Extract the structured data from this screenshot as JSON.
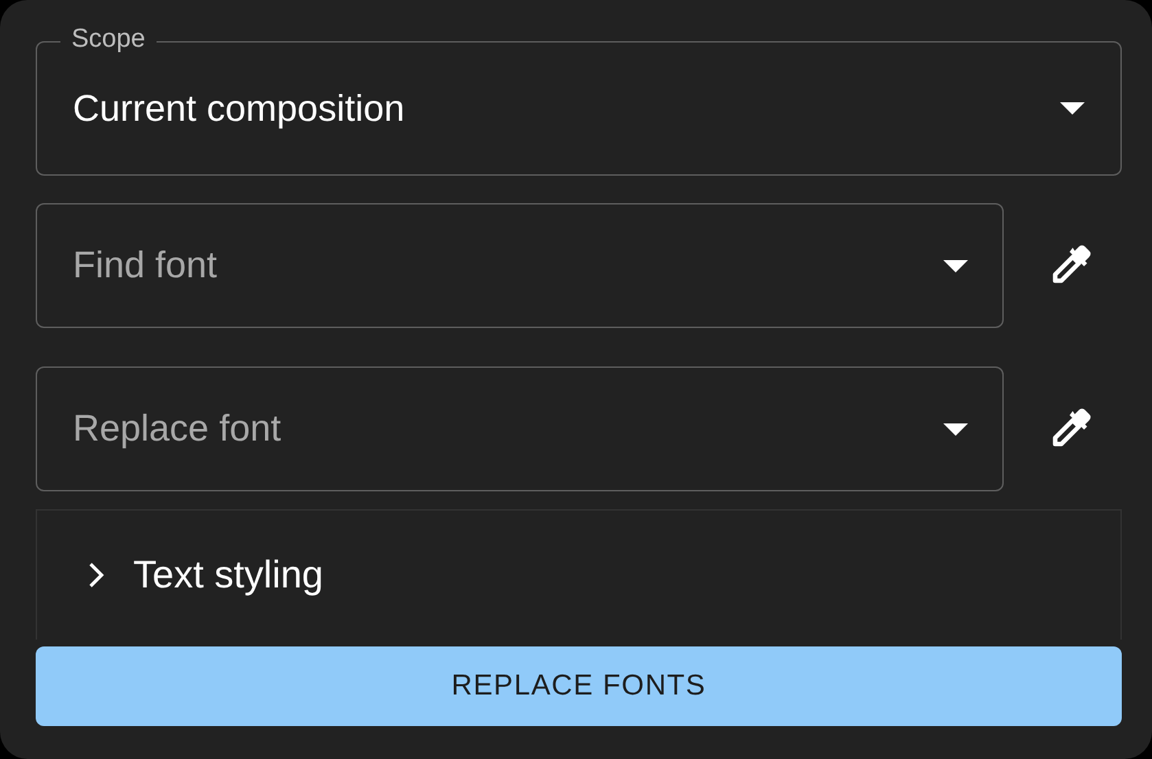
{
  "scope": {
    "label": "Scope",
    "value": "Current composition"
  },
  "find_font": {
    "placeholder": "Find font"
  },
  "replace_font": {
    "placeholder": "Replace font"
  },
  "text_styling": {
    "label": "Text styling",
    "expanded": false
  },
  "button": {
    "label": "REPLACE FONTS"
  }
}
